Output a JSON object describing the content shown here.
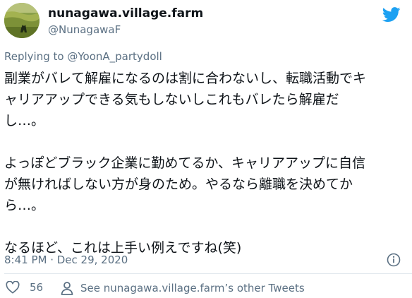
{
  "author": {
    "name": "nunagawa.village.farm",
    "handle": "@NunagawaF",
    "avatar_icon": "landscape-avatar"
  },
  "reply_context": {
    "prefix": "Replying to",
    "mention": "@YoonA_partydoll"
  },
  "tweet": {
    "lines": [
      "副業がバレて解雇になるのは割に合わないし、転職活動でキ",
      "ャリアアップできる気もしないしこれもバレたら解雇だ",
      "し…。",
      "",
      "よっぽどブラック企業に勤めてるか、キャリアアップに自信",
      "が無ければしない方が身のため。やるなら離職を決めてか",
      "ら…。",
      "",
      "なるほど、これは上手い例えですね(笑)"
    ]
  },
  "meta": {
    "timestamp": "8:41 PM · Dec 29, 2020"
  },
  "actions": {
    "like_count": "56",
    "other_tweets_label": "See nunagawa.village.farm’s other Tweets"
  },
  "icons": {
    "brand": "twitter-bird-icon",
    "info": "info-icon",
    "like": "heart-icon",
    "profile": "person-icon"
  },
  "colors": {
    "twitter_blue": "#1da1f2",
    "text_primary": "#0f1419",
    "text_secondary": "#5b7083",
    "divider": "#e1e8ed"
  }
}
